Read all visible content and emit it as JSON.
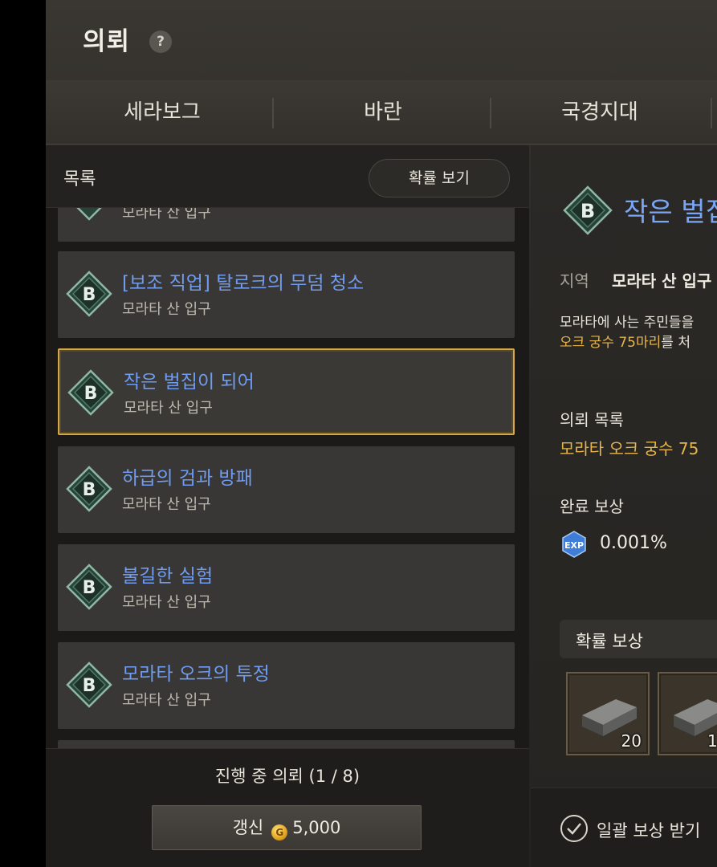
{
  "header": {
    "title": "의뢰",
    "help_glyph": "?"
  },
  "tabs": [
    {
      "label": "세라보그"
    },
    {
      "label": "바란"
    },
    {
      "label": "국경지대"
    }
  ],
  "list": {
    "title": "목록",
    "probability_button": "확률 보기",
    "partial_top_location": "모라타 산 입구",
    "quests": [
      {
        "grade": "B",
        "title": "[보조 직업] 탈로크의 무덤 청소",
        "location": "모라타 산 입구",
        "selected": false
      },
      {
        "grade": "B",
        "title": "작은 벌집이 되어",
        "location": "모라타 산 입구",
        "selected": true
      },
      {
        "grade": "B",
        "title": "하급의 검과 방패",
        "location": "모라타 산 입구",
        "selected": false
      },
      {
        "grade": "B",
        "title": "불길한 실험",
        "location": "모라타 산 입구",
        "selected": false
      },
      {
        "grade": "B",
        "title": "모라타 오크의 투정",
        "location": "모라타 산 입구",
        "selected": false
      }
    ],
    "progress_text": "진행 중 의뢰 (1 / 8)",
    "refresh_button": {
      "label": "갱신",
      "cost": "5,000",
      "icon": "gold-coin-icon"
    }
  },
  "detail": {
    "grade": "B",
    "title": "작은 벌집이 되어",
    "region_label": "지역",
    "region_value": "모라타 산 입구",
    "description_line1": "모라타에 사는 주민들을",
    "description_line2_highlight": "오크 궁수 75마리",
    "description_line2_rest": "를 처",
    "objectives_label": "의뢰 목록",
    "objective": "모라타 오크 궁수 75",
    "reward_label": "완료 보상",
    "exp_icon": "EXP",
    "exp_value": "0.001%",
    "probability_reward_label": "확률 보상",
    "items": [
      {
        "icon": "stone-ingot-icon",
        "count": "20"
      },
      {
        "icon": "stone-ingot-icon",
        "count": "1"
      }
    ],
    "collect_all_label": "일괄 보상 받기"
  },
  "colors": {
    "quest_title": "#6f9cf0",
    "highlight": "#e8b54a",
    "selected_border": "#d4a84a"
  }
}
